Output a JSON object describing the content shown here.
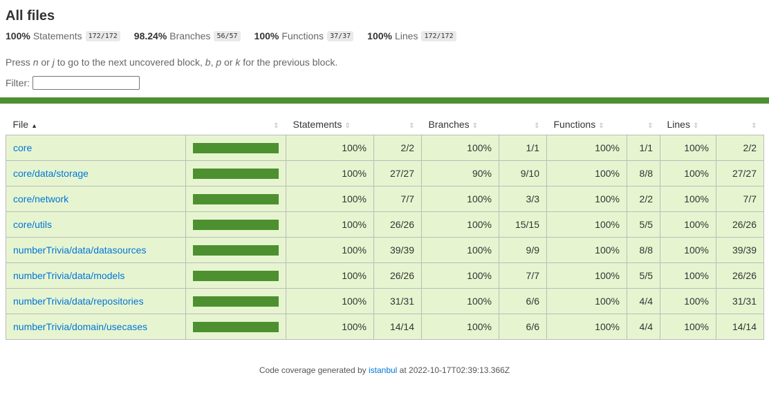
{
  "header": {
    "title": "All files",
    "summary": [
      {
        "pct": "100%",
        "label": "Statements",
        "fraction": "172/172"
      },
      {
        "pct": "98.24%",
        "label": "Branches",
        "fraction": "56/57"
      },
      {
        "pct": "100%",
        "label": "Functions",
        "fraction": "37/37"
      },
      {
        "pct": "100%",
        "label": "Lines",
        "fraction": "172/172"
      }
    ],
    "hint": {
      "p1": "Press ",
      "k1": "n",
      "p2": " or ",
      "k2": "j",
      "p3": " to go to the next uncovered block, ",
      "k3": "b",
      "p4": ", ",
      "k4": "p",
      "p5": " or ",
      "k5": "k",
      "p6": " for the previous block."
    },
    "filter_label": "Filter:",
    "filter_value": ""
  },
  "colors": {
    "high": "#4d9030",
    "row_bg": "#e6f5d0",
    "link": "#0074d9"
  },
  "table": {
    "columns": {
      "file": "File",
      "statements": "Statements",
      "branches": "Branches",
      "functions": "Functions",
      "lines": "Lines"
    },
    "sort_asc_icon": "▲",
    "sort_icon": "⇕",
    "rows": [
      {
        "file": "core",
        "coverage": 1.0,
        "st_pct": "100%",
        "st_frac": "2/2",
        "br_pct": "100%",
        "br_frac": "1/1",
        "fn_pct": "100%",
        "fn_frac": "1/1",
        "ln_pct": "100%",
        "ln_frac": "2/2"
      },
      {
        "file": "core/data/storage",
        "coverage": 1.0,
        "st_pct": "100%",
        "st_frac": "27/27",
        "br_pct": "90%",
        "br_frac": "9/10",
        "fn_pct": "100%",
        "fn_frac": "8/8",
        "ln_pct": "100%",
        "ln_frac": "27/27"
      },
      {
        "file": "core/network",
        "coverage": 1.0,
        "st_pct": "100%",
        "st_frac": "7/7",
        "br_pct": "100%",
        "br_frac": "3/3",
        "fn_pct": "100%",
        "fn_frac": "2/2",
        "ln_pct": "100%",
        "ln_frac": "7/7"
      },
      {
        "file": "core/utils",
        "coverage": 1.0,
        "st_pct": "100%",
        "st_frac": "26/26",
        "br_pct": "100%",
        "br_frac": "15/15",
        "fn_pct": "100%",
        "fn_frac": "5/5",
        "ln_pct": "100%",
        "ln_frac": "26/26"
      },
      {
        "file": "numberTrivia/data/datasources",
        "coverage": 1.0,
        "st_pct": "100%",
        "st_frac": "39/39",
        "br_pct": "100%",
        "br_frac": "9/9",
        "fn_pct": "100%",
        "fn_frac": "8/8",
        "ln_pct": "100%",
        "ln_frac": "39/39"
      },
      {
        "file": "numberTrivia/data/models",
        "coverage": 1.0,
        "st_pct": "100%",
        "st_frac": "26/26",
        "br_pct": "100%",
        "br_frac": "7/7",
        "fn_pct": "100%",
        "fn_frac": "5/5",
        "ln_pct": "100%",
        "ln_frac": "26/26"
      },
      {
        "file": "numberTrivia/data/repositories",
        "coverage": 1.0,
        "st_pct": "100%",
        "st_frac": "31/31",
        "br_pct": "100%",
        "br_frac": "6/6",
        "fn_pct": "100%",
        "fn_frac": "4/4",
        "ln_pct": "100%",
        "ln_frac": "31/31"
      },
      {
        "file": "numberTrivia/domain/usecases",
        "coverage": 1.0,
        "st_pct": "100%",
        "st_frac": "14/14",
        "br_pct": "100%",
        "br_frac": "6/6",
        "fn_pct": "100%",
        "fn_frac": "4/4",
        "ln_pct": "100%",
        "ln_frac": "14/14"
      }
    ]
  },
  "footer": {
    "prefix": "Code coverage generated by ",
    "link": "istanbul",
    "suffix": " at 2022-10-17T02:39:13.366Z"
  }
}
